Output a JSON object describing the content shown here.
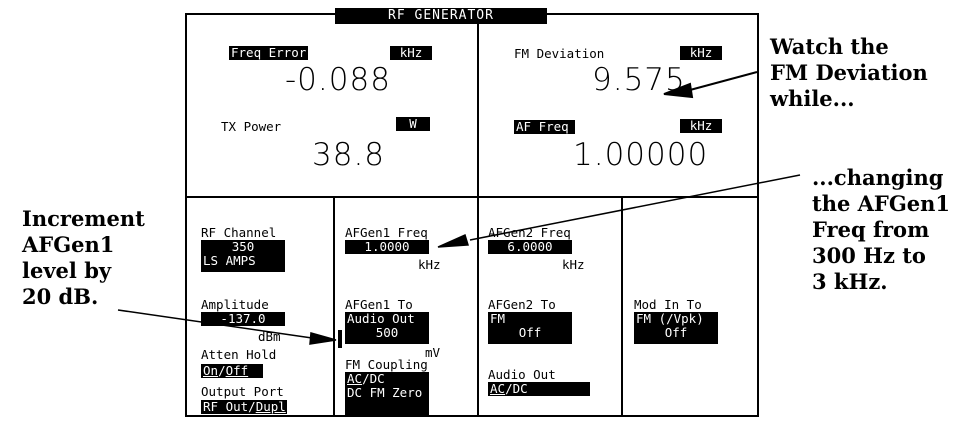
{
  "title": "RF GENERATOR",
  "meters": {
    "freq_error": {
      "label": "Freq Error",
      "unit": "kHz",
      "value": "-0.088"
    },
    "fm_deviation": {
      "label": "FM Deviation",
      "unit": "kHz",
      "value": "9.575"
    },
    "tx_power": {
      "label": "TX Power",
      "unit": "W",
      "value": "38.8"
    },
    "af_freq": {
      "label": "AF Freq",
      "unit": "kHz",
      "value": "1.00000"
    }
  },
  "fields": {
    "rf_channel": {
      "label": "RF Channel",
      "value1": "350",
      "value2": "LS AMPS"
    },
    "amplitude": {
      "label": "Amplitude",
      "value": "-137.0",
      "unit": "dBm"
    },
    "atten_hold": {
      "label": "Atten Hold",
      "on": "On",
      "sep": "/",
      "off": "Off"
    },
    "output_port": {
      "label": "Output Port",
      "rf": "RF Out",
      "sep": "/",
      "dupl": "Dupl"
    },
    "afgen1_freq": {
      "label": "AFGen1 Freq",
      "value": "1.0000",
      "unit": "kHz"
    },
    "afgen1_to": {
      "label": "AFGen1 To",
      "dest": "Audio Out",
      "level": "500",
      "unit": "mV"
    },
    "fm_coupling": {
      "label": "FM Coupling",
      "ac": "AC",
      "dc": "/DC",
      "zero": "DC FM Zero"
    },
    "afgen2_freq": {
      "label": "AFGen2 Freq",
      "value": "6.0000",
      "unit": "kHz"
    },
    "afgen2_to": {
      "label": "AFGen2 To",
      "dest": "FM",
      "level": "Off"
    },
    "audio_out": {
      "label": "Audio Out",
      "ac": "AC",
      "dc": "/DC"
    },
    "mod_in_to": {
      "label": "Mod In To",
      "dest": "FM (/Vpk)",
      "level": "Off"
    }
  },
  "annotations": {
    "watch": "Watch the\nFM Deviation\nwhile...",
    "changing": "...changing\nthe AFGen1\nFreq from\n300 Hz to\n3 kHz.",
    "increment": "Increment\nAFGen1\nlevel by\n20 dB."
  }
}
